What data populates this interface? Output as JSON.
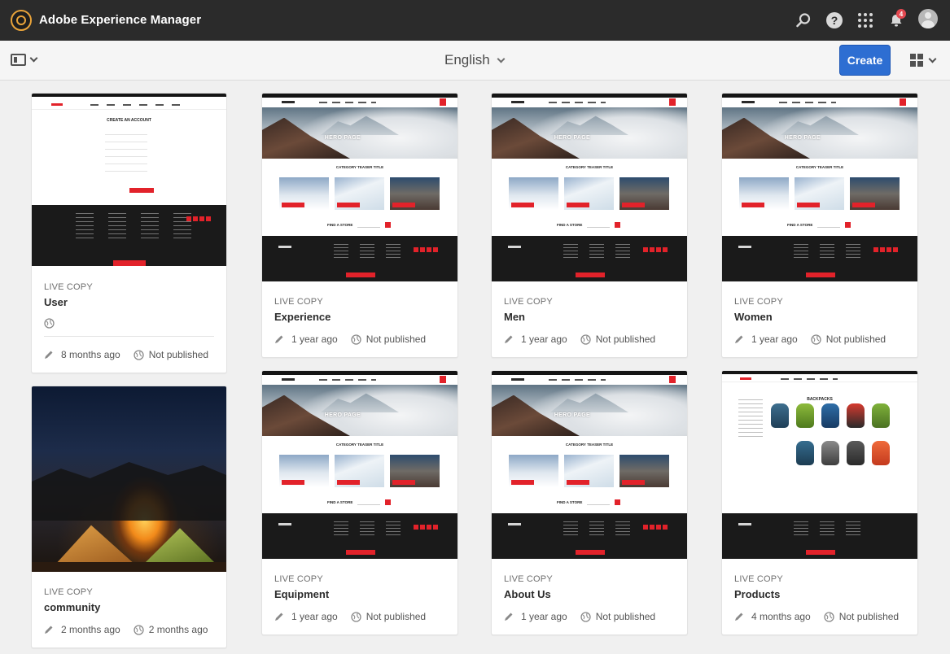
{
  "app": {
    "title": "Adobe Experience Manager",
    "notification_count": "4"
  },
  "actionbar": {
    "language": "English",
    "create_label": "Create"
  },
  "icons": {
    "logo": "aem-logo-icon",
    "search": "search-icon",
    "help": "help-icon",
    "apps": "apps-grid-icon",
    "notifications": "bell-icon",
    "avatar": "user-avatar-icon",
    "rail": "side-rail-toggle-icon",
    "view": "card-view-icon",
    "modified": "pencil-icon",
    "publish": "globe-icon"
  },
  "help_glyph": "?",
  "thumbnail_text": {
    "hero": "HERO PAGE",
    "category": "CATEGORY TEASER TITLE",
    "store": "FIND A STORE",
    "account": "CREATE AN ACCOUNT",
    "backpacks": "BACKPACKS"
  },
  "colors": {
    "shell": "#2b2b2b",
    "accent": "#2d6ed2",
    "brand_red": "#e2222a",
    "notification": "#e34850"
  },
  "cards": [
    {
      "kind": "LIVE COPY",
      "name": "User",
      "modified": "8 months ago",
      "status": "Not published"
    },
    {
      "kind": "LIVE COPY",
      "name": "Experience",
      "modified": "1 year ago",
      "status": "Not published"
    },
    {
      "kind": "LIVE COPY",
      "name": "Men",
      "modified": "1 year ago",
      "status": "Not published"
    },
    {
      "kind": "LIVE COPY",
      "name": "Women",
      "modified": "1 year ago",
      "status": "Not published"
    },
    {
      "kind": "LIVE COPY",
      "name": "community",
      "modified": "2 months ago",
      "status": "2 months ago"
    },
    {
      "kind": "LIVE COPY",
      "name": "Equipment",
      "modified": "1 year ago",
      "status": "Not published"
    },
    {
      "kind": "LIVE COPY",
      "name": "About Us",
      "modified": "1 year ago",
      "status": "Not published"
    },
    {
      "kind": "LIVE COPY",
      "name": "Products",
      "modified": "4 months ago",
      "status": "Not published"
    }
  ]
}
